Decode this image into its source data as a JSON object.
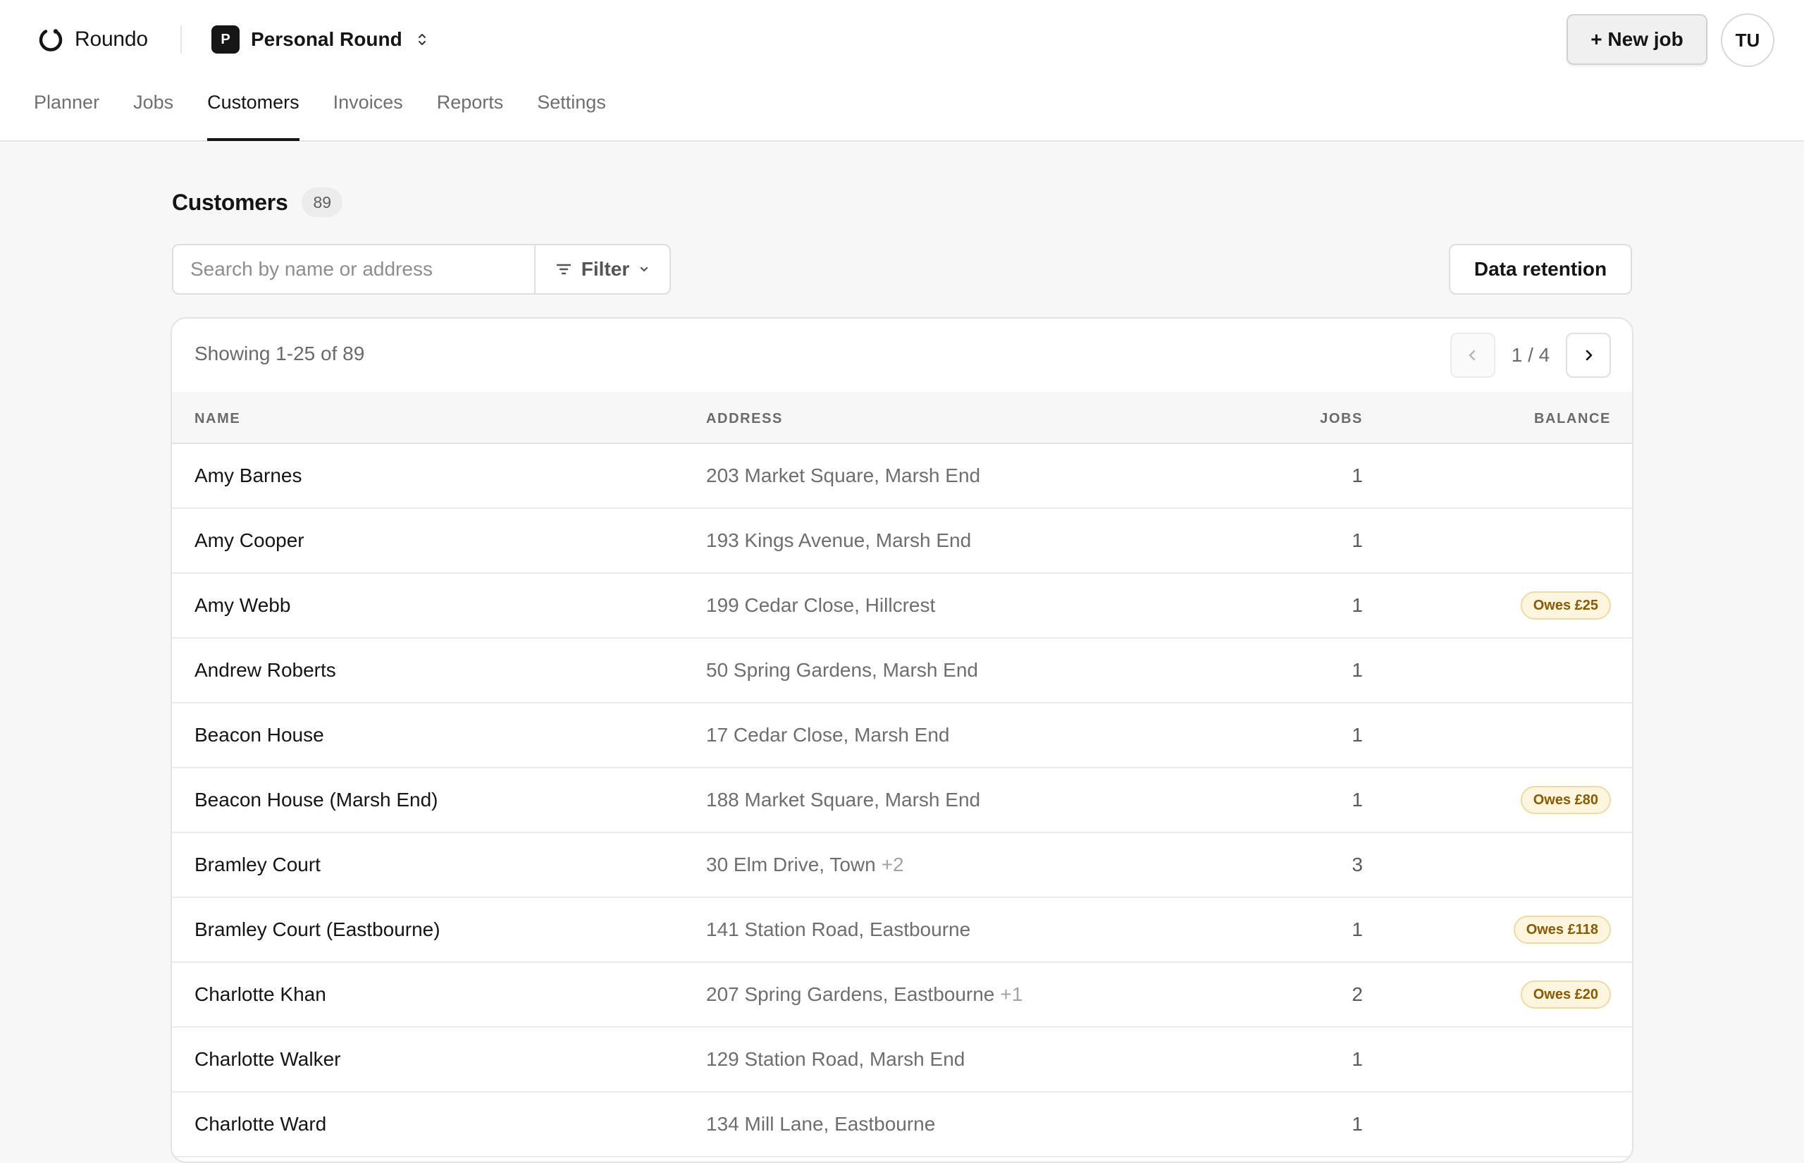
{
  "brand": {
    "name": "Roundo",
    "logo_icon": "roundo-logo-icon"
  },
  "workspace": {
    "initial": "P",
    "name": "Personal Round",
    "switch_icon": "chevron-up-down-icon"
  },
  "header": {
    "new_job_label": "+ New job",
    "avatar_initials": "TU"
  },
  "nav": {
    "tabs": [
      {
        "label": "Planner",
        "active": false
      },
      {
        "label": "Jobs",
        "active": false
      },
      {
        "label": "Customers",
        "active": true
      },
      {
        "label": "Invoices",
        "active": false
      },
      {
        "label": "Reports",
        "active": false
      },
      {
        "label": "Settings",
        "active": false
      }
    ]
  },
  "page": {
    "title": "Customers",
    "count": "89"
  },
  "toolbar": {
    "search_placeholder": "Search by name or address",
    "search_value": "",
    "filter_label": "Filter",
    "filter_icon": "filter-lines-icon",
    "filter_chevron": "chevron-down-icon",
    "retention_label": "Data retention"
  },
  "table": {
    "showing": "Showing 1-25 of 89",
    "page_indicator": "1 / 4",
    "columns": {
      "name": "NAME",
      "address": "ADDRESS",
      "jobs": "JOBS",
      "balance": "BALANCE"
    },
    "rows": [
      {
        "name": "Amy Barnes",
        "address": "203 Market Square, Marsh End",
        "address_extra": "",
        "jobs": "1",
        "balance": ""
      },
      {
        "name": "Amy Cooper",
        "address": "193 Kings Avenue, Marsh End",
        "address_extra": "",
        "jobs": "1",
        "balance": ""
      },
      {
        "name": "Amy Webb",
        "address": "199 Cedar Close, Hillcrest",
        "address_extra": "",
        "jobs": "1",
        "balance": "Owes £25"
      },
      {
        "name": "Andrew Roberts",
        "address": "50 Spring Gardens, Marsh End",
        "address_extra": "",
        "jobs": "1",
        "balance": ""
      },
      {
        "name": "Beacon House",
        "address": "17 Cedar Close, Marsh End",
        "address_extra": "",
        "jobs": "1",
        "balance": ""
      },
      {
        "name": "Beacon House (Marsh End)",
        "address": "188 Market Square, Marsh End",
        "address_extra": "",
        "jobs": "1",
        "balance": "Owes £80"
      },
      {
        "name": "Bramley Court",
        "address": "30 Elm Drive, Town",
        "address_extra": "+2",
        "jobs": "3",
        "balance": ""
      },
      {
        "name": "Bramley Court (Eastbourne)",
        "address": "141 Station Road, Eastbourne",
        "address_extra": "",
        "jobs": "1",
        "balance": "Owes £118"
      },
      {
        "name": "Charlotte Khan",
        "address": "207 Spring Gardens, Eastbourne",
        "address_extra": "+1",
        "jobs": "2",
        "balance": "Owes £20"
      },
      {
        "name": "Charlotte Walker",
        "address": "129 Station Road, Marsh End",
        "address_extra": "",
        "jobs": "1",
        "balance": ""
      },
      {
        "name": "Charlotte Ward",
        "address": "134 Mill Lane, Eastbourne",
        "address_extra": "",
        "jobs": "1",
        "balance": ""
      }
    ]
  },
  "colors": {
    "active_tab": "#151515",
    "owes_badge_bg": "#fdf5dd",
    "owes_badge_text": "#8a5a00",
    "owes_badge_border": "#ecdba6"
  }
}
